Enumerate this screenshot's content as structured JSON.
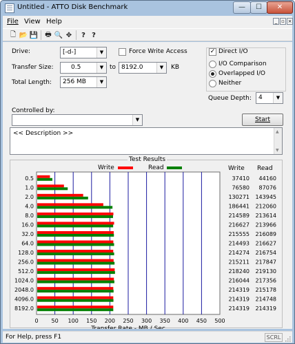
{
  "window": {
    "title": "Untitled - ATTO Disk Benchmark",
    "min_glyph": "—",
    "max_glyph": "☐",
    "close_glyph": "✕"
  },
  "menu": {
    "items": [
      "File",
      "View",
      "Help"
    ],
    "mdi_min": "_",
    "mdi_restore": "▫",
    "mdi_close": "×"
  },
  "toolbar": {
    "icons": [
      "new-file-icon",
      "open-folder-icon",
      "save-icon",
      "print-icon",
      "print-preview-icon",
      "move-icon",
      "help-icon",
      "context-help-icon"
    ],
    "glyphs": [
      "🗋",
      "📂",
      "💾",
      "🖶",
      "🔍",
      "✥",
      "?",
      "?"
    ]
  },
  "settings": {
    "drive_label": "Drive:",
    "drive_value": "[-d-]",
    "force_write_label": "Force Write Access",
    "force_write_checked": false,
    "direct_io_label": "Direct I/O",
    "direct_io_checked": true,
    "transfer_size_label": "Transfer Size:",
    "transfer_size_from": "0.5",
    "transfer_size_to_label": "to",
    "transfer_size_to": "8192.0",
    "transfer_size_unit": "KB",
    "total_length_label": "Total Length:",
    "total_length_value": "256 MB",
    "io_comparison_label": "I/O Comparison",
    "overlapped_io_label": "Overlapped I/O",
    "neither_label": "Neither",
    "selected_io_mode": "Overlapped I/O",
    "queue_depth_label": "Queue Depth:",
    "queue_depth_value": "4",
    "controlled_by_label": "Controlled by:",
    "controlled_by_value": "",
    "start_label": "Start",
    "description_text": "<< Description >>"
  },
  "results": {
    "title": "Test Results",
    "write_legend": "Write",
    "read_legend": "Read",
    "write_col": "Write",
    "read_col": "Read",
    "write_color": "#ff0000",
    "read_color": "#008000",
    "xlabel": "Transfer Rate - MB / Sec"
  },
  "chart_data": {
    "type": "bar",
    "orientation": "horizontal",
    "categories": [
      "0.5",
      "1.0",
      "2.0",
      "4.0",
      "8.0",
      "16.0",
      "32.0",
      "64.0",
      "128.0",
      "256.0",
      "512.0",
      "1024.0",
      "2048.0",
      "4096.0",
      "8192.0"
    ],
    "series": [
      {
        "name": "Write",
        "color": "#ff0000",
        "values": [
          37410,
          76580,
          130271,
          186441,
          214589,
          216627,
          215555,
          214493,
          214274,
          215211,
          218240,
          216044,
          214319,
          214319,
          214319
        ]
      },
      {
        "name": "Read",
        "color": "#008000",
        "values": [
          44160,
          87076,
          143945,
          212060,
          213614,
          213966,
          216089,
          216627,
          216754,
          217847,
          219130,
          217356,
          215178,
          214748,
          214319
        ]
      }
    ],
    "xlabel": "Transfer Rate - MB / Sec",
    "xticks": [
      0,
      50,
      100,
      150,
      200,
      250,
      300,
      350,
      400,
      450,
      500
    ],
    "xlim": [
      0,
      500
    ],
    "value_unit": "KB/s",
    "grid": true
  },
  "status": {
    "help_text": "For Help, press F1",
    "indicator": "SCRL"
  }
}
